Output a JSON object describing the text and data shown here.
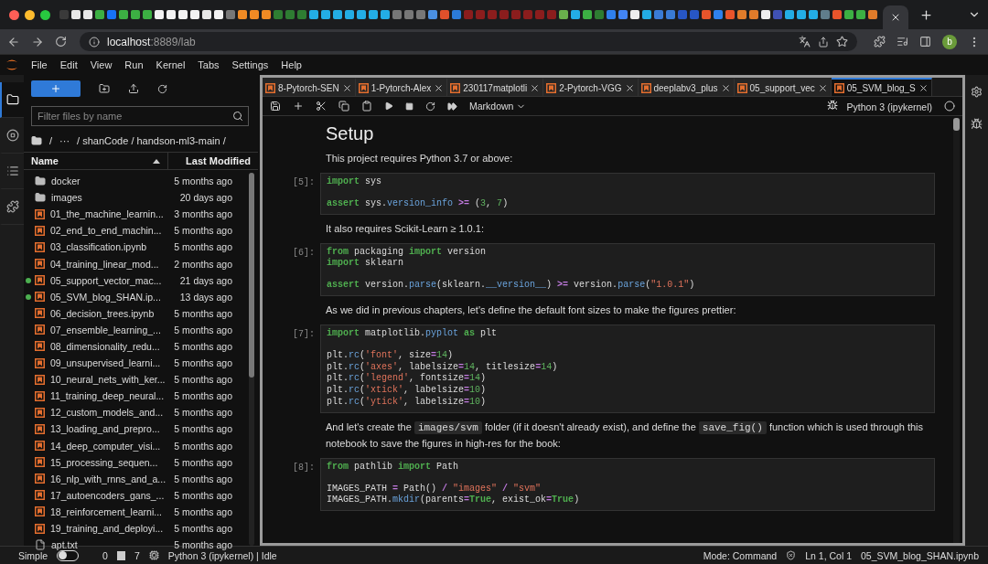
{
  "browser": {
    "favicons": [
      {
        "color": "#3a3a3a"
      },
      {
        "color": "#e8e8e8"
      },
      {
        "color": "#e8e8e8"
      },
      {
        "color": "#3cb043"
      },
      {
        "color": "#1772f6"
      },
      {
        "color": "#3cb043"
      },
      {
        "color": "#3cb043"
      },
      {
        "color": "#3cb043"
      },
      {
        "color": "#f2f2f2"
      },
      {
        "color": "#f2f2f2"
      },
      {
        "color": "#f2f2f2"
      },
      {
        "color": "#f2f2f2"
      },
      {
        "color": "#e8e8e8"
      },
      {
        "color": "#f2f2f2"
      },
      {
        "color": "#777777"
      },
      {
        "color": "#f08a24"
      },
      {
        "color": "#f08a24"
      },
      {
        "color": "#f08a24"
      },
      {
        "color": "#2e7d32"
      },
      {
        "color": "#2e7d32"
      },
      {
        "color": "#2e7d32"
      },
      {
        "color": "#23ade5"
      },
      {
        "color": "#23ade5"
      },
      {
        "color": "#23ade5"
      },
      {
        "color": "#23ade5"
      },
      {
        "color": "#23ade5"
      },
      {
        "color": "#23ade5"
      },
      {
        "color": "#23ade5"
      },
      {
        "color": "#777777"
      },
      {
        "color": "#777777"
      },
      {
        "color": "#777777"
      },
      {
        "color": "#4a90e2"
      },
      {
        "color": "#e0502b"
      },
      {
        "color": "#2b7bd9"
      },
      {
        "color": "#8b1d1d"
      },
      {
        "color": "#8b1d1d"
      },
      {
        "color": "#8b1d1d"
      },
      {
        "color": "#8b1d1d"
      },
      {
        "color": "#8b1d1d"
      },
      {
        "color": "#8b1d1d"
      },
      {
        "color": "#8b1d1d"
      },
      {
        "color": "#8b1d1d"
      },
      {
        "color": "#6ab04c"
      },
      {
        "color": "#23ade5"
      },
      {
        "color": "#3cb043"
      },
      {
        "color": "#2e7d32"
      },
      {
        "color": "#2f80ed"
      },
      {
        "color": "#4285f4"
      },
      {
        "color": "#eeeeee"
      },
      {
        "color": "#23ade5"
      },
      {
        "color": "#3a7bd5"
      },
      {
        "color": "#3a7bd5"
      },
      {
        "color": "#2756c5"
      },
      {
        "color": "#2756c5"
      },
      {
        "color": "#e8542b"
      },
      {
        "color": "#2f80ed"
      },
      {
        "color": "#e8542b"
      },
      {
        "color": "#e07b2a"
      },
      {
        "color": "#e07b2a"
      },
      {
        "color": "#eeeeee"
      },
      {
        "color": "#3f51b5"
      },
      {
        "color": "#23ade5"
      },
      {
        "color": "#23ade5"
      },
      {
        "color": "#23ade5"
      },
      {
        "color": "#607d8b"
      },
      {
        "color": "#e8542b"
      },
      {
        "color": "#3cb043"
      },
      {
        "color": "#3cb043"
      },
      {
        "color": "#e07b2a"
      }
    ],
    "address": {
      "host": "localhost",
      "path": ":8889/lab"
    },
    "avatar": "b"
  },
  "menu": [
    "File",
    "Edit",
    "View",
    "Run",
    "Kernel",
    "Tabs",
    "Settings",
    "Help"
  ],
  "activity_bar": [
    {
      "kind": "folder",
      "selected": true
    },
    {
      "kind": "running",
      "selected": false
    },
    {
      "kind": "toc",
      "selected": false
    },
    {
      "kind": "extensions",
      "selected": false
    }
  ],
  "file_browser": {
    "filter_placeholder": "Filter files by name",
    "breadcrumb": [
      "/",
      "···",
      "/ shanCode / handson-ml3-main /"
    ],
    "columns": [
      "Name",
      "Last Modified"
    ],
    "files": [
      {
        "name": "docker",
        "modified": "5 months ago",
        "kind": "folder",
        "running": false
      },
      {
        "name": "images",
        "modified": "20 days ago",
        "kind": "folder",
        "running": false
      },
      {
        "name": "01_the_machine_learnin...",
        "modified": "3 months ago",
        "kind": "notebook",
        "running": false
      },
      {
        "name": "02_end_to_end_machin...",
        "modified": "5 months ago",
        "kind": "notebook",
        "running": false
      },
      {
        "name": "03_classification.ipynb",
        "modified": "5 months ago",
        "kind": "notebook",
        "running": false
      },
      {
        "name": "04_training_linear_mod...",
        "modified": "2 months ago",
        "kind": "notebook",
        "running": false
      },
      {
        "name": "05_support_vector_mac...",
        "modified": "21 days ago",
        "kind": "notebook",
        "running": true
      },
      {
        "name": "05_SVM_blog_SHAN.ip...",
        "modified": "13 days ago",
        "kind": "notebook",
        "running": true
      },
      {
        "name": "06_decision_trees.ipynb",
        "modified": "5 months ago",
        "kind": "notebook",
        "running": false
      },
      {
        "name": "07_ensemble_learning_...",
        "modified": "5 months ago",
        "kind": "notebook",
        "running": false
      },
      {
        "name": "08_dimensionality_redu...",
        "modified": "5 months ago",
        "kind": "notebook",
        "running": false
      },
      {
        "name": "09_unsupervised_learni...",
        "modified": "5 months ago",
        "kind": "notebook",
        "running": false
      },
      {
        "name": "10_neural_nets_with_ker...",
        "modified": "5 months ago",
        "kind": "notebook",
        "running": false
      },
      {
        "name": "11_training_deep_neural...",
        "modified": "5 months ago",
        "kind": "notebook",
        "running": false
      },
      {
        "name": "12_custom_models_and...",
        "modified": "5 months ago",
        "kind": "notebook",
        "running": false
      },
      {
        "name": "13_loading_and_prepro...",
        "modified": "5 months ago",
        "kind": "notebook",
        "running": false
      },
      {
        "name": "14_deep_computer_visi...",
        "modified": "5 months ago",
        "kind": "notebook",
        "running": false
      },
      {
        "name": "15_processing_sequen...",
        "modified": "5 months ago",
        "kind": "notebook",
        "running": false
      },
      {
        "name": "16_nlp_with_rnns_and_a...",
        "modified": "5 months ago",
        "kind": "notebook",
        "running": false
      },
      {
        "name": "17_autoencoders_gans_...",
        "modified": "5 months ago",
        "kind": "notebook",
        "running": false
      },
      {
        "name": "18_reinforcement_learni...",
        "modified": "5 months ago",
        "kind": "notebook",
        "running": false
      },
      {
        "name": "19_training_and_deployi...",
        "modified": "5 months ago",
        "kind": "notebook",
        "running": false
      },
      {
        "name": "apt.txt",
        "modified": "5 months ago",
        "kind": "file",
        "running": false
      }
    ]
  },
  "notebook_tabs": [
    {
      "label": "8-Pytorch-SEN",
      "selected": false
    },
    {
      "label": "1-Pytorch-Alex",
      "selected": false
    },
    {
      "label": "230117matplotli",
      "selected": false
    },
    {
      "label": "2-Pytorch-VGG",
      "selected": false
    },
    {
      "label": "deeplabv3_plus",
      "selected": false
    },
    {
      "label": "05_support_vec",
      "selected": false
    },
    {
      "label": "05_SVM_blog_S",
      "selected": true
    }
  ],
  "toolbar": {
    "cell_type": "Markdown",
    "kernel": "Python 3 (ipykernel)"
  },
  "cells": [
    {
      "kind": "heading",
      "text": "Setup"
    },
    {
      "kind": "markdown",
      "parts": [
        {
          "text": "This project requires Python 3.7 or above:",
          "code": false
        }
      ]
    },
    {
      "kind": "code",
      "prompt": "[5]:",
      "blocks": [
        [
          [
            {
              "text": "import",
              "kind": "kw"
            },
            {
              "text": " sys",
              "kind": "plain"
            }
          ]
        ],
        [
          [
            {
              "text": "assert",
              "kind": "kw"
            },
            {
              "text": " sys.",
              "kind": "plain"
            },
            {
              "text": "version_info",
              "kind": "attr"
            },
            {
              "text": " >=",
              "kind": "op"
            },
            {
              "text": " (",
              "kind": "plain"
            },
            {
              "text": "3",
              "kind": "num"
            },
            {
              "text": ", ",
              "kind": "plain"
            },
            {
              "text": "7",
              "kind": "num"
            },
            {
              "text": ")",
              "kind": "plain"
            }
          ]
        ]
      ]
    },
    {
      "kind": "markdown",
      "parts": [
        {
          "text": "It also requires Scikit-Learn ≥ 1.0.1:",
          "code": false
        }
      ]
    },
    {
      "kind": "code",
      "prompt": "[6]:",
      "blocks": [
        [
          [
            {
              "text": "from",
              "kind": "kw"
            },
            {
              "text": " packaging ",
              "kind": "plain"
            },
            {
              "text": "import",
              "kind": "kw"
            },
            {
              "text": " version",
              "kind": "plain"
            }
          ],
          [
            {
              "text": "import",
              "kind": "kw"
            },
            {
              "text": " sklearn",
              "kind": "plain"
            }
          ]
        ],
        [
          [
            {
              "text": "assert",
              "kind": "kw"
            },
            {
              "text": " version.",
              "kind": "plain"
            },
            {
              "text": "parse",
              "kind": "attr"
            },
            {
              "text": "(sklearn.",
              "kind": "plain"
            },
            {
              "text": "__version__",
              "kind": "attr"
            },
            {
              "text": ") ",
              "kind": "plain"
            },
            {
              "text": ">=",
              "kind": "op"
            },
            {
              "text": " version.",
              "kind": "plain"
            },
            {
              "text": "parse",
              "kind": "attr"
            },
            {
              "text": "(",
              "kind": "plain"
            },
            {
              "text": "\"1.0.1\"",
              "kind": "str"
            },
            {
              "text": ")",
              "kind": "plain"
            }
          ]
        ]
      ]
    },
    {
      "kind": "markdown",
      "parts": [
        {
          "text": "As we did in previous chapters, let's define the default font sizes to make the figures prettier:",
          "code": false
        }
      ]
    },
    {
      "kind": "code",
      "prompt": "[7]:",
      "blocks": [
        [
          [
            {
              "text": "import",
              "kind": "kw"
            },
            {
              "text": " matplotlib.",
              "kind": "plain"
            },
            {
              "text": "pyplot",
              "kind": "attr"
            },
            {
              "text": " as",
              "kind": "kw"
            },
            {
              "text": " plt",
              "kind": "plain"
            }
          ]
        ],
        [
          [
            {
              "text": "plt.",
              "kind": "plain"
            },
            {
              "text": "rc",
              "kind": "attr"
            },
            {
              "text": "(",
              "kind": "plain"
            },
            {
              "text": "'font'",
              "kind": "str"
            },
            {
              "text": ", size",
              "kind": "plain"
            },
            {
              "text": "=",
              "kind": "op"
            },
            {
              "text": "14",
              "kind": "num"
            },
            {
              "text": ")",
              "kind": "plain"
            }
          ],
          [
            {
              "text": "plt.",
              "kind": "plain"
            },
            {
              "text": "rc",
              "kind": "attr"
            },
            {
              "text": "(",
              "kind": "plain"
            },
            {
              "text": "'axes'",
              "kind": "str"
            },
            {
              "text": ", labelsize",
              "kind": "plain"
            },
            {
              "text": "=",
              "kind": "op"
            },
            {
              "text": "14",
              "kind": "num"
            },
            {
              "text": ", titlesize",
              "kind": "plain"
            },
            {
              "text": "=",
              "kind": "op"
            },
            {
              "text": "14",
              "kind": "num"
            },
            {
              "text": ")",
              "kind": "plain"
            }
          ],
          [
            {
              "text": "plt.",
              "kind": "plain"
            },
            {
              "text": "rc",
              "kind": "attr"
            },
            {
              "text": "(",
              "kind": "plain"
            },
            {
              "text": "'legend'",
              "kind": "str"
            },
            {
              "text": ", fontsize",
              "kind": "plain"
            },
            {
              "text": "=",
              "kind": "op"
            },
            {
              "text": "14",
              "kind": "num"
            },
            {
              "text": ")",
              "kind": "plain"
            }
          ],
          [
            {
              "text": "plt.",
              "kind": "plain"
            },
            {
              "text": "rc",
              "kind": "attr"
            },
            {
              "text": "(",
              "kind": "plain"
            },
            {
              "text": "'xtick'",
              "kind": "str"
            },
            {
              "text": ", labelsize",
              "kind": "plain"
            },
            {
              "text": "=",
              "kind": "op"
            },
            {
              "text": "10",
              "kind": "num"
            },
            {
              "text": ")",
              "kind": "plain"
            }
          ],
          [
            {
              "text": "plt.",
              "kind": "plain"
            },
            {
              "text": "rc",
              "kind": "attr"
            },
            {
              "text": "(",
              "kind": "plain"
            },
            {
              "text": "'ytick'",
              "kind": "str"
            },
            {
              "text": ", labelsize",
              "kind": "plain"
            },
            {
              "text": "=",
              "kind": "op"
            },
            {
              "text": "10",
              "kind": "num"
            },
            {
              "text": ")",
              "kind": "plain"
            }
          ]
        ]
      ]
    },
    {
      "kind": "markdown",
      "parts": [
        {
          "text": "And let's create the ",
          "code": false
        },
        {
          "text": "images/svm",
          "code": true
        },
        {
          "text": " folder (if it doesn't already exist), and define the ",
          "code": false
        },
        {
          "text": "save_fig()",
          "code": true
        },
        {
          "text": " function which is used through this notebook to save the figures in high-res for the book:",
          "code": false
        }
      ]
    },
    {
      "kind": "code",
      "prompt": "[8]:",
      "blocks": [
        [
          [
            {
              "text": "from",
              "kind": "kw"
            },
            {
              "text": " pathlib ",
              "kind": "plain"
            },
            {
              "text": "import",
              "kind": "kw"
            },
            {
              "text": " Path",
              "kind": "plain"
            }
          ]
        ],
        [
          [
            {
              "text": "IMAGES_PATH ",
              "kind": "plain"
            },
            {
              "text": "=",
              "kind": "op"
            },
            {
              "text": " Path() ",
              "kind": "plain"
            },
            {
              "text": "/",
              "kind": "op"
            },
            {
              "text": " \"images\" ",
              "kind": "str"
            },
            {
              "text": "/",
              "kind": "op"
            },
            {
              "text": " \"svm\"",
              "kind": "str"
            }
          ],
          [
            {
              "text": "IMAGES_PATH.",
              "kind": "plain"
            },
            {
              "text": "mkdir",
              "kind": "attr"
            },
            {
              "text": "(parents",
              "kind": "plain"
            },
            {
              "text": "=",
              "kind": "op"
            },
            {
              "text": "True",
              "kind": "kw"
            },
            {
              "text": ", exist_ok",
              "kind": "plain"
            },
            {
              "text": "=",
              "kind": "op"
            },
            {
              "text": "True",
              "kind": "kw"
            },
            {
              "text": ")",
              "kind": "plain"
            }
          ]
        ]
      ]
    }
  ],
  "status_bar": {
    "simple_label": "Simple",
    "simple_on": false,
    "terminals": "0",
    "kernels": "7",
    "kernel_status": "Python 3 (ipykernel) | Idle",
    "mode": "Mode: Command",
    "position": "Ln 1, Col 1",
    "file": "05_SVM_blog_SHAN.ipynb"
  }
}
